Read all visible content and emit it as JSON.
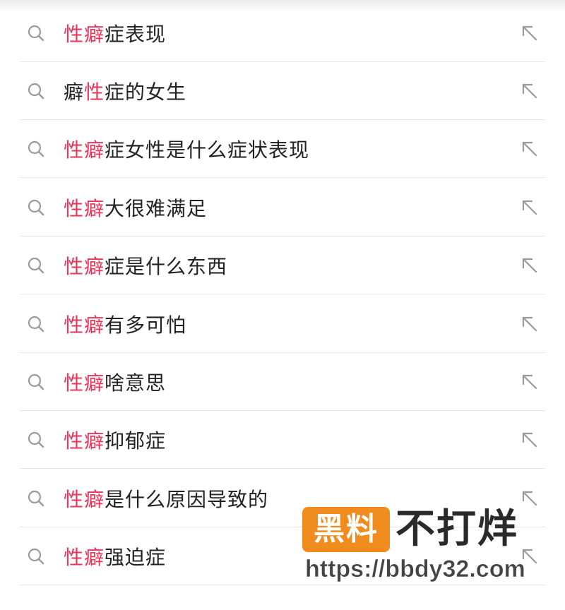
{
  "suggestions": [
    {
      "highlight": "性癖",
      "prefix": "",
      "rest": "症表现"
    },
    {
      "highlight": "性",
      "prefix": "癖",
      "rest": "症的女生"
    },
    {
      "highlight": "性癖",
      "prefix": "",
      "rest": "症女性是什么症状表现"
    },
    {
      "highlight": "性癖",
      "prefix": "",
      "rest": "大很难满足"
    },
    {
      "highlight": "性癖",
      "prefix": "",
      "rest": "症是什么东西"
    },
    {
      "highlight": "性癖",
      "prefix": "",
      "rest": "有多可怕"
    },
    {
      "highlight": "性癖",
      "prefix": "",
      "rest": "啥意思"
    },
    {
      "highlight": "性癖",
      "prefix": "",
      "rest": "抑郁症"
    },
    {
      "highlight": "性癖",
      "prefix": "",
      "rest": "是什么原因导致的"
    },
    {
      "highlight": "性癖",
      "prefix": "",
      "rest": "强迫症"
    }
  ],
  "colors": {
    "highlight": "#e8365a",
    "text": "#222222",
    "icon": "#9a9a9a",
    "divider": "#e6e6e6",
    "watermark_box": "#f08c1e"
  },
  "icons": {
    "leading": "search-icon",
    "trailing": "fill-query-arrow-icon"
  },
  "watermark": {
    "badge": "黑料",
    "title": "不打烊",
    "url": "https://bbdy32.com"
  }
}
